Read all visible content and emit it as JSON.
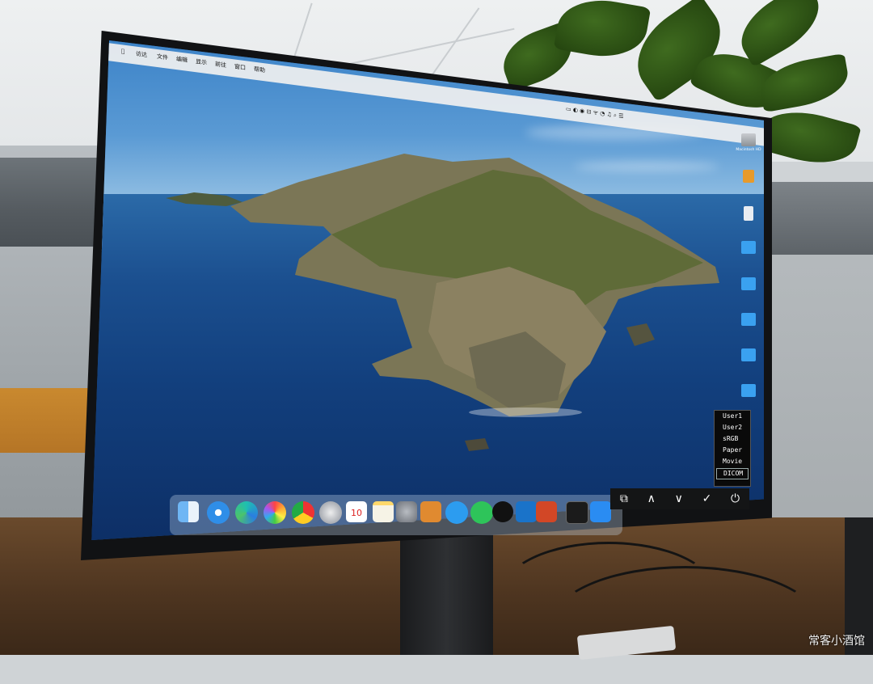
{
  "menubar": {
    "apple": "",
    "items": [
      "访达",
      "文件",
      "编辑",
      "显示",
      "前往",
      "窗口",
      "帮助"
    ]
  },
  "desktop_icons": [
    {
      "label": "Macintosh HD",
      "icon": "disk-icon"
    },
    {
      "label": "",
      "icon": "document-icon"
    },
    {
      "label": "",
      "icon": "document-icon"
    },
    {
      "label": "",
      "icon": "folder-icon"
    },
    {
      "label": "",
      "icon": "folder-icon"
    },
    {
      "label": "",
      "icon": "folder-icon"
    },
    {
      "label": "",
      "icon": "folder-icon"
    },
    {
      "label": "",
      "icon": "folder-icon"
    }
  ],
  "osd_menu": {
    "items": [
      "User1",
      "User2",
      "sRGB",
      "Paper",
      "Movie",
      "DICOM"
    ],
    "selected": "DICOM"
  },
  "osd_buttons": [
    "⧉",
    "∧",
    "∨",
    "✓",
    "⏻"
  ],
  "dock": [
    "finder",
    "safari",
    "edge",
    "photos",
    "chrome",
    "launchpad",
    "calendar",
    "notes",
    "system-preferences",
    "books",
    "messages",
    "wechat",
    "qq",
    "outlook",
    "powerpoint",
    "terminal",
    "app-store"
  ],
  "calendar_day": "10",
  "watermark": "常客小酒馆",
  "colors": {
    "sea": "#123f7d",
    "sky": "#5a9ad4",
    "folder": "#3aa1f0"
  }
}
